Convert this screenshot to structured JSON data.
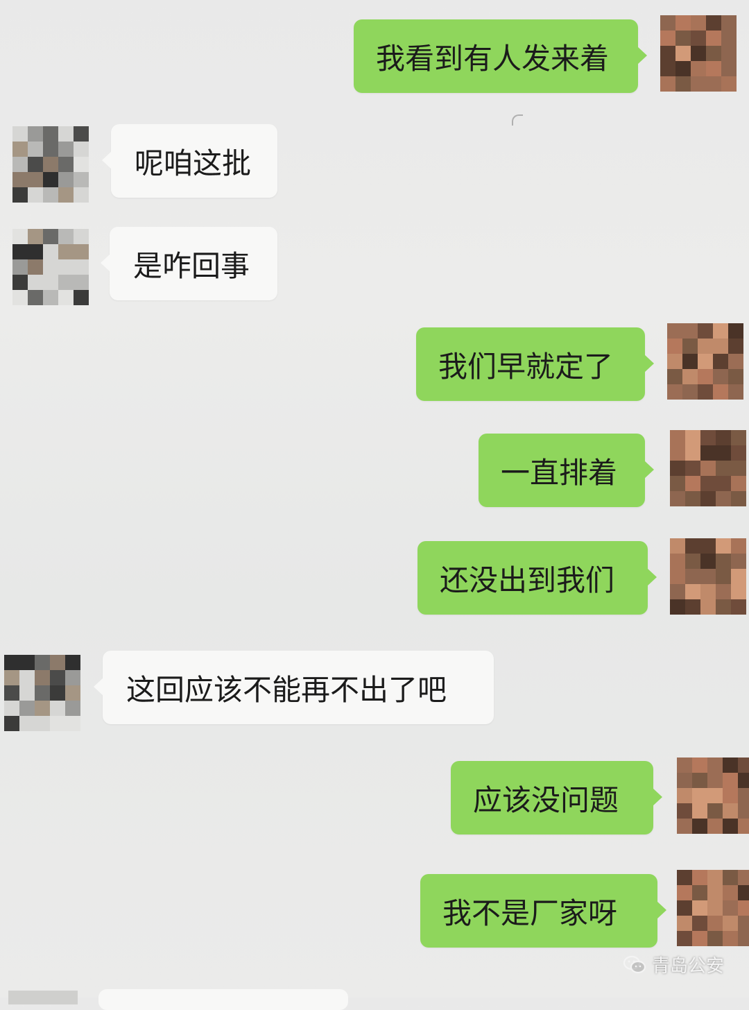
{
  "chat": {
    "messages": [
      {
        "side": "out",
        "text": "我看到有人发来着"
      },
      {
        "side": "in",
        "text": "呢咱这批"
      },
      {
        "side": "in",
        "text": "是咋回事"
      },
      {
        "side": "out",
        "text": "我们早就定了"
      },
      {
        "side": "out",
        "text": "一直排着"
      },
      {
        "side": "out",
        "text": "还没出到我们"
      },
      {
        "side": "in",
        "text": "这回应该不能再不出了吧"
      },
      {
        "side": "out",
        "text": "应该没问题"
      },
      {
        "side": "out",
        "text": "我不是厂家呀"
      }
    ]
  },
  "watermark": {
    "text": "青岛公安",
    "icon": "wechat-icon"
  },
  "colors": {
    "outgoing_bubble": "#8fd65c",
    "incoming_bubble": "#f8f8f7",
    "background": "#eaeaea"
  }
}
